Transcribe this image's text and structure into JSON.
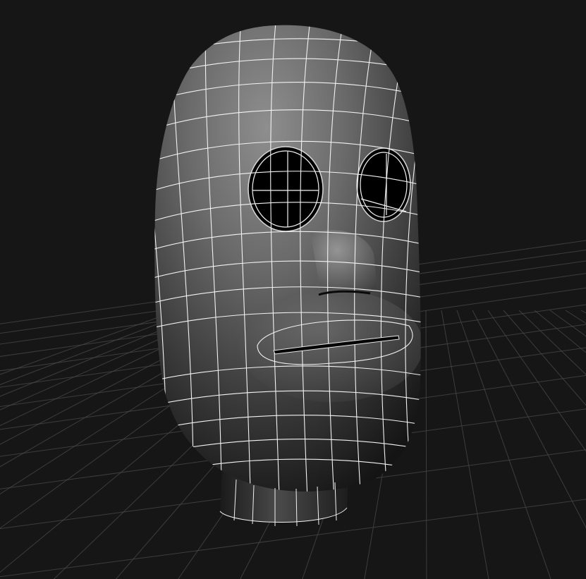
{
  "viewport": {
    "background_color": "#161616",
    "grid_color": "#4a4a4a",
    "wire_color": "#f2f2f2",
    "grid_visible": true,
    "display_mode": "smooth-shade-with-wireframe"
  },
  "model": {
    "object": "head",
    "surface_light_color": "#8c8c8c",
    "surface_dark_color": "#101010",
    "eye_hole_color": "#000000"
  }
}
